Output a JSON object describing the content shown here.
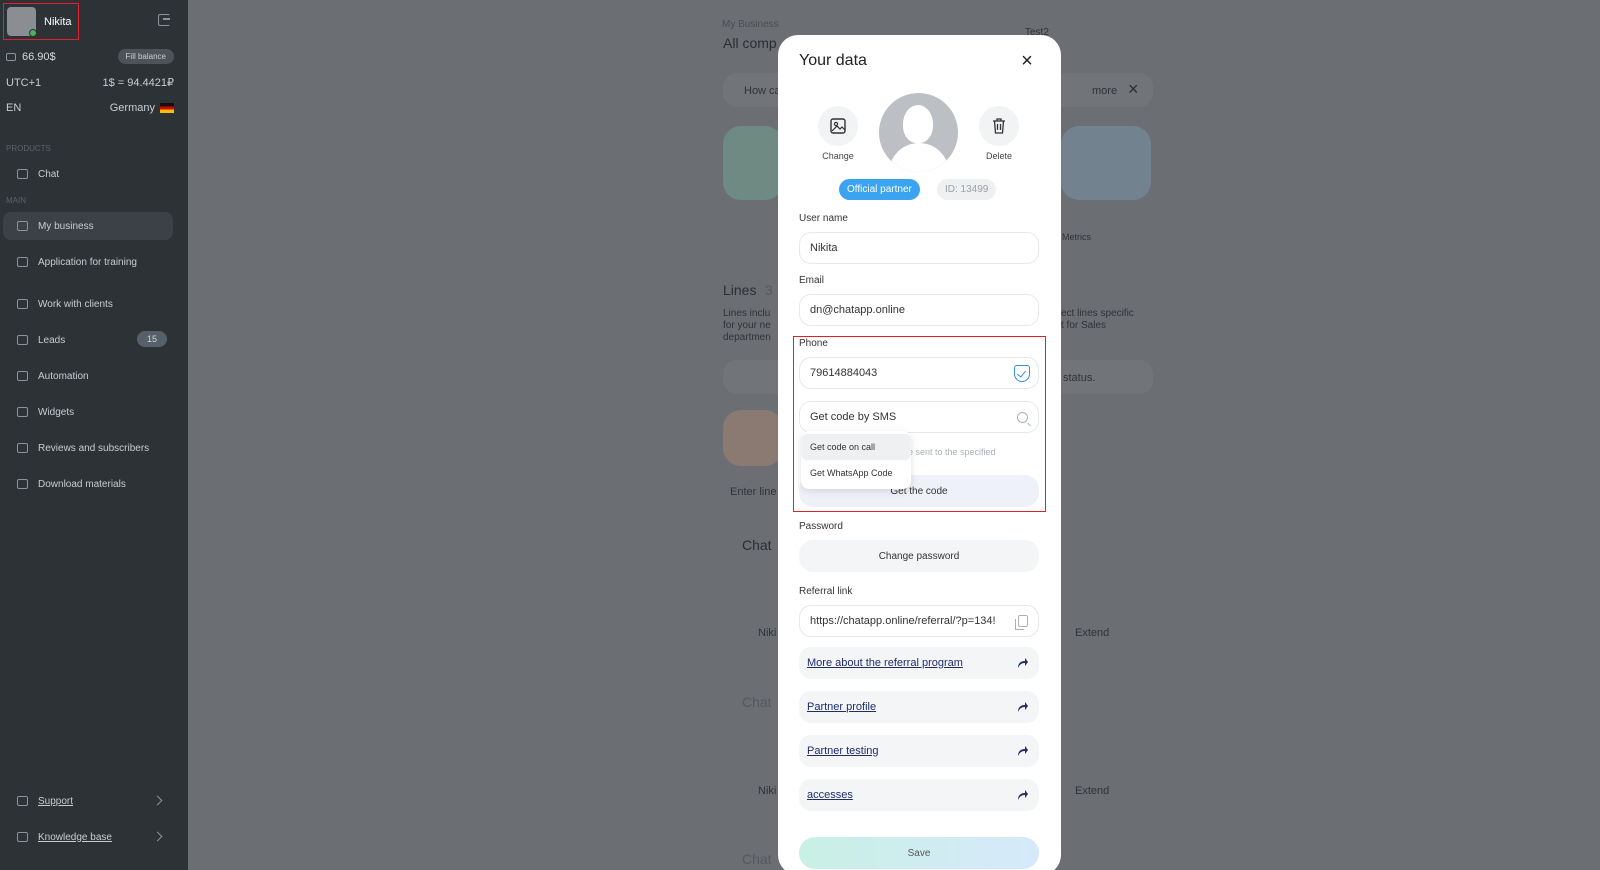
{
  "sidebar": {
    "user": {
      "name": "Nikita"
    },
    "balance": {
      "amount": "66.90$",
      "fill_label": "Fill balance"
    },
    "timezone": "UTC+1",
    "rate": "1$ = 94.4421₽",
    "language": "EN",
    "country": "Germany",
    "sections": {
      "products": "PRODUCTS",
      "main": "MAIN"
    },
    "items": [
      {
        "label": "Chat",
        "icon": "chat-icon"
      },
      {
        "label": "My business",
        "icon": "business-icon"
      },
      {
        "label": "Application for training",
        "icon": "training-icon"
      },
      {
        "label": "Work with clients",
        "icon": "clients-icon"
      },
      {
        "label": "Leads",
        "icon": "leads-icon",
        "badge": "15"
      },
      {
        "label": "Automation",
        "icon": "automation-icon"
      },
      {
        "label": "Widgets",
        "icon": "widgets-icon"
      },
      {
        "label": "Reviews and subscribers",
        "icon": "reviews-icon"
      },
      {
        "label": "Download materials",
        "icon": "download-icon"
      }
    ],
    "bottom": [
      {
        "label": "Support",
        "icon": "support-icon"
      },
      {
        "label": "Knowledge base",
        "icon": "knowledge-icon"
      }
    ]
  },
  "background": {
    "breadcrumb": "My Business",
    "title": "All comp",
    "select_value": "Test2",
    "how": "How ca",
    "more": "more",
    "metrics": "Metrics",
    "lines_title": "Lines",
    "lines_count": "3",
    "lines_desc_left": "Lines inclu",
    "lines_desc_left2": "for your ne",
    "lines_desc_left3": "departmen",
    "lines_desc_right": "ect lines specific",
    "lines_desc_right2": "t for Sales",
    "status_text": "status.",
    "search_placeholder": "Enter line",
    "card1": "Chat",
    "card2": "Chat",
    "card3": "Chat",
    "user_short": "Niki",
    "extend": "Extend"
  },
  "modal": {
    "title": "Your data",
    "change_label": "Change",
    "delete_label": "Delete",
    "partner_badge": "Official partner",
    "id_badge": "ID: 13499",
    "username_label": "User name",
    "username_value": "Nikita",
    "email_label": "Email",
    "email_value": "dn@chatapp.online",
    "phone_label": "Phone",
    "phone_value": "79614884043",
    "code_method_value": "Get code by SMS",
    "helper_text": "be sent to the specified",
    "dropdown_options": [
      "Get code on call",
      "Get WhatsApp Code"
    ],
    "get_code_button": "Get the code",
    "password_label": "Password",
    "change_password_button": "Change password",
    "referral_label": "Referral link",
    "referral_value": "https://chatapp.online/referral/?p=134!",
    "links": [
      "More about the referral program",
      "Partner profile",
      "Partner testing",
      "accesses"
    ],
    "save_button": "Save"
  },
  "colors": {
    "accent": "#3aa4f0",
    "highlight_border": "#e0202a",
    "sidebar_bg": "#2d3237"
  }
}
